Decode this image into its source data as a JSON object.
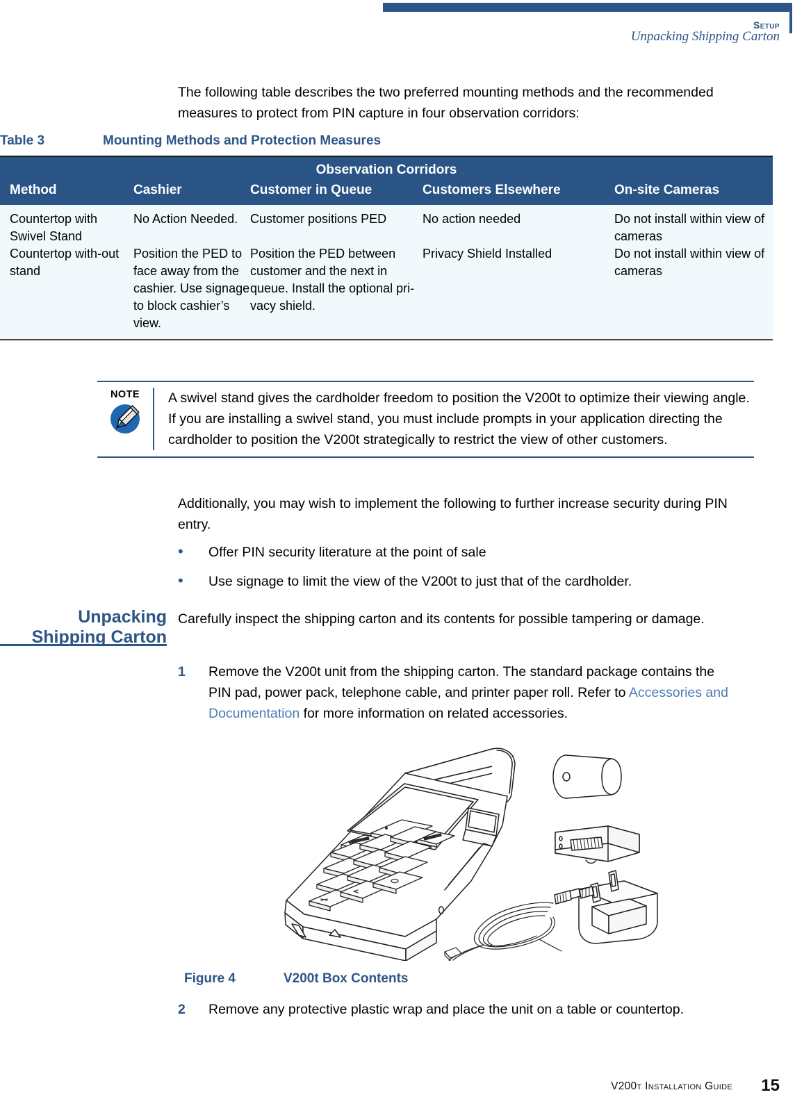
{
  "header": {
    "chapter": "Setup",
    "chapter_first": "S",
    "chapter_rest": "ETUP",
    "section": "Unpacking Shipping Carton",
    "bar_color": "#2d5587"
  },
  "intro_paragraph": "The following table describes the two preferred mounting methods and the recommended measures to protect from PIN capture in four observation corridors:",
  "table": {
    "caption_number": "Table 3",
    "caption_title": "Mounting Methods and Protection Measures",
    "group_header": "Observation Corridors",
    "header_color": "#2a5485",
    "row_color": "#f1f9fc",
    "columns": [
      "Method",
      "Cashier",
      "Customer in Queue",
      "Customers Elsewhere",
      "On-site Cameras"
    ],
    "rows": [
      [
        "Countertop with Swivel Stand",
        "No Action Needed.",
        "Customer positions PED",
        "No action needed",
        "Do not install within view of cameras"
      ],
      [
        "Countertop with-out stand",
        "Position the PED to face away from the cashier. Use signage to block cashier’s view.",
        "Position the PED between customer and the next in queue. Install the optional pri-vacy shield.",
        "Privacy Shield Installed",
        "Do not install within view of cameras"
      ]
    ]
  },
  "note": {
    "label": "NOTE",
    "icon": "pencil-icon",
    "text": "A swivel stand gives the cardholder freedom to position the V200t to optimize their viewing angle. If you are installing a swivel stand, you must include prompts in your application directing the cardholder to position the V200t strategically to restrict the view of other customers."
  },
  "additional_paragraph": "Additionally, you may wish to implement the following to further increase security during PIN entry.",
  "bullets": [
    "Offer PIN security literature at the point of sale",
    "Use signage to limit the view of the V200t to just that of the cardholder."
  ],
  "side_heading": {
    "line1": "Unpacking",
    "line2": "Shipping Carton",
    "color": "#2d5587"
  },
  "steps": {
    "intro": "Carefully inspect the shipping carton and its contents for possible tampering or damage.",
    "items": [
      {
        "number": "1",
        "part1": "Remove the V200t unit from the shipping carton. The standard package contains the PIN pad, power pack, telephone cable, and printer paper roll. Refer to ",
        "xref": "Accessories and Documentation",
        "part2": " for more information on related accessories."
      },
      {
        "number": "2",
        "text": "Remove any protective plastic wrap and place the unit on a table or countertop."
      }
    ]
  },
  "figure": {
    "caption_number": "Figure 4",
    "caption_title": "V200t Box Contents",
    "contents": [
      "payment-terminal",
      "paper-roll",
      "battery-module",
      "power-adapter-with-cable",
      "telephone-cable"
    ]
  },
  "footer": {
    "guide_name": "V200t Installation Guide",
    "page_number": "15"
  }
}
